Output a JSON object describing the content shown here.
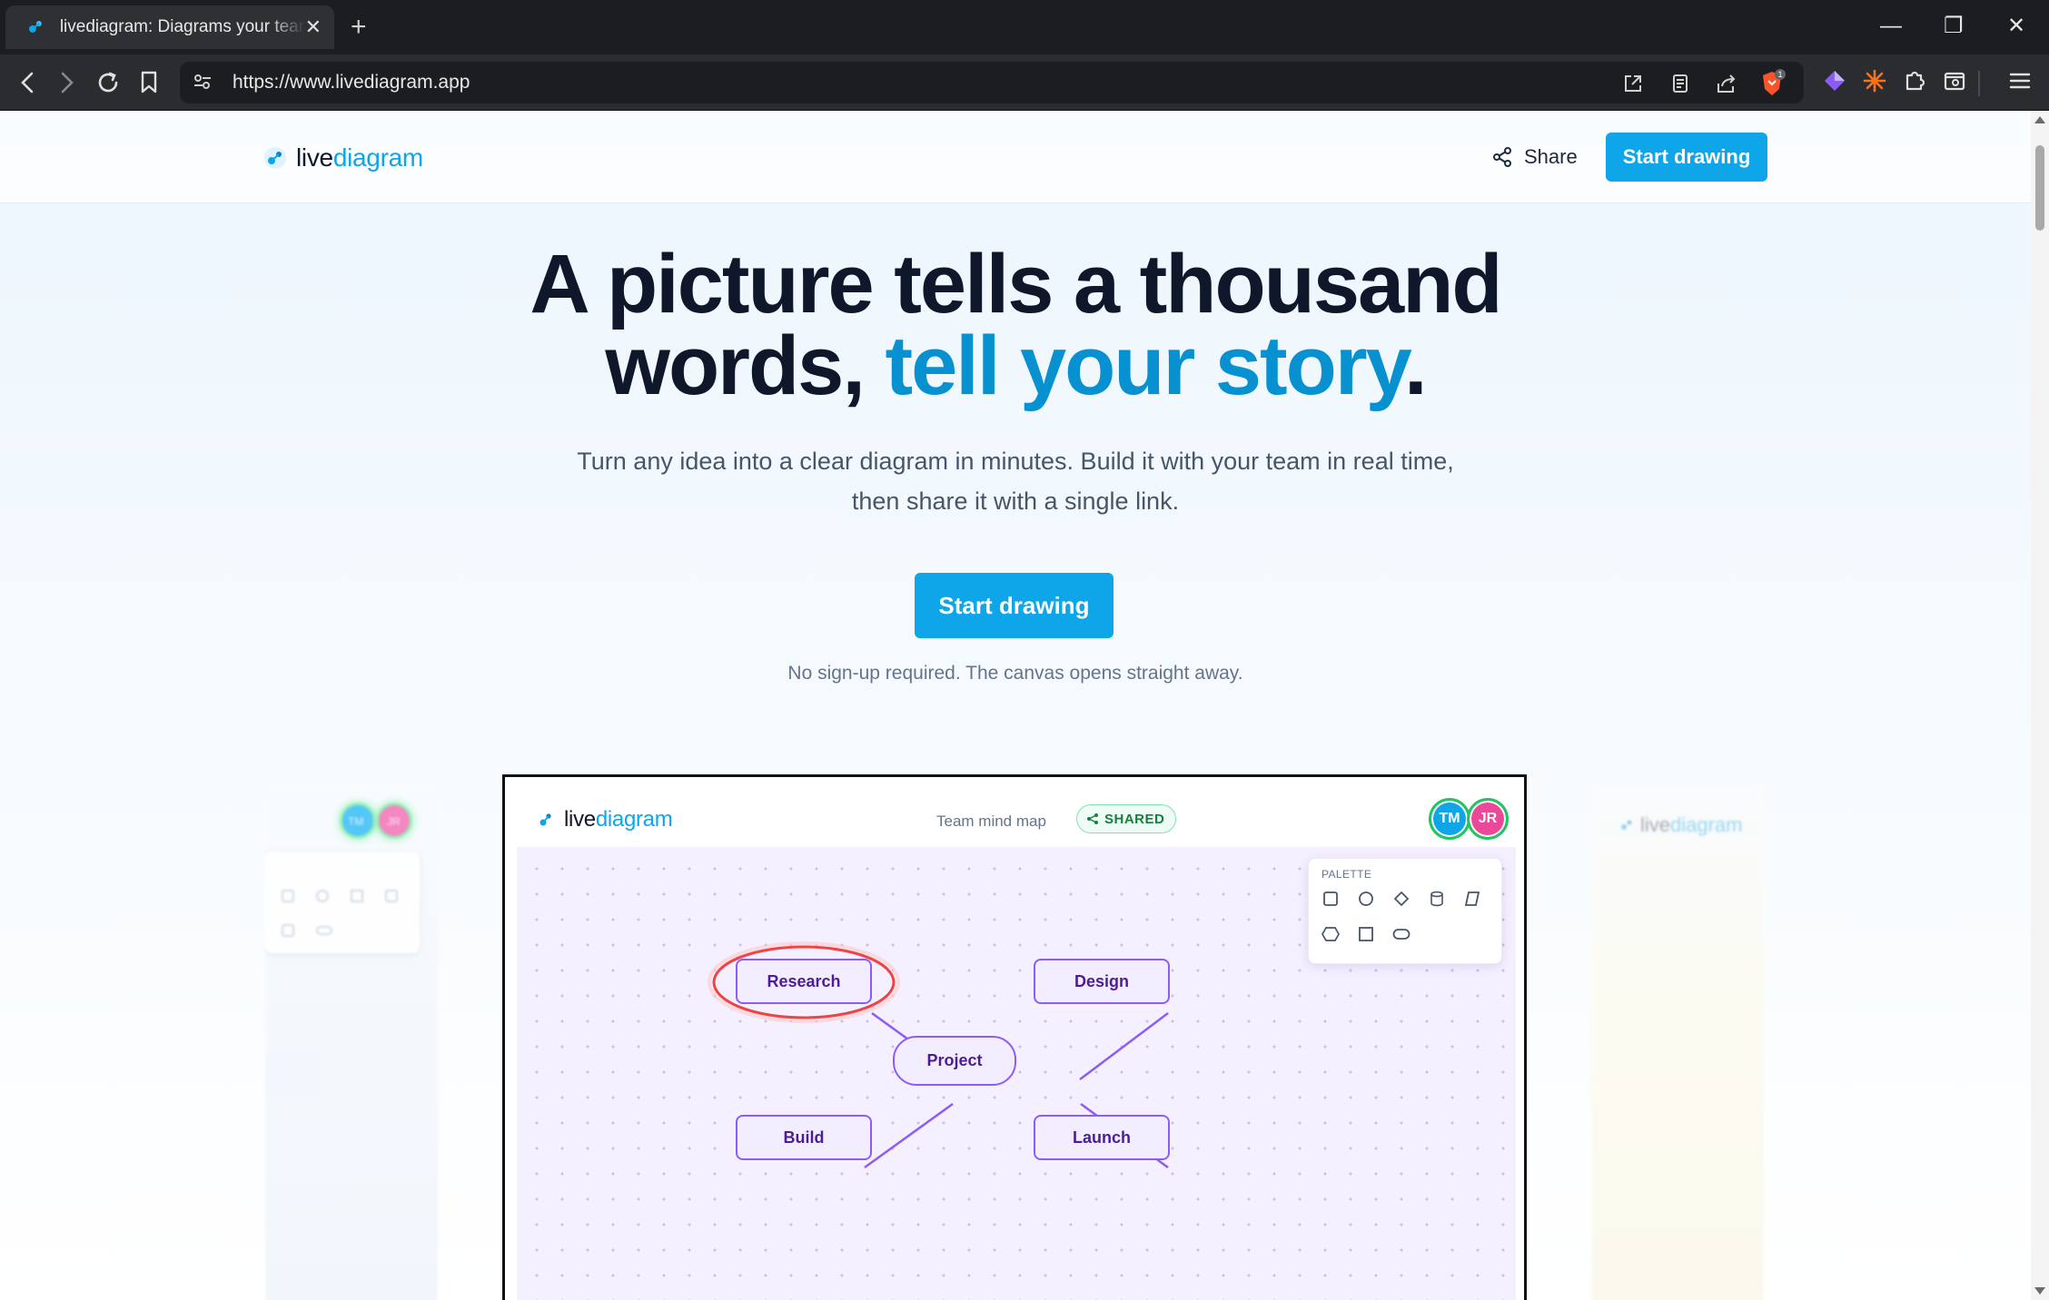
{
  "browser": {
    "tab_title": "livediagram: Diagrams your team",
    "tab_close": "✕",
    "new_tab": "+",
    "url": "https://www.livediagram.app",
    "nav": {
      "back": "‹",
      "forward": "›",
      "reload": "⟳"
    },
    "window": {
      "minimize": "—",
      "restore": "❐",
      "close": "✕"
    },
    "extension_badge_count": "1"
  },
  "header": {
    "brand_part1": "live",
    "brand_part2": "diagram",
    "share_label": "Share",
    "cta_label": "Start drawing"
  },
  "hero": {
    "title_line1": "A picture tells a thousand",
    "title_line2_prefix": "words, ",
    "title_accent": "tell your story",
    "title_suffix": ".",
    "subtitle_line1": "Turn any idea into a clear diagram in minutes. Build it with your team in real time,",
    "subtitle_line2": "then share it with a single link.",
    "cta_label": "Start drawing",
    "note": "No sign-up required. The canvas opens straight away."
  },
  "preview": {
    "brand_part1": "live",
    "brand_part2": "diagram",
    "doc_title": "Team mind map",
    "badge": "SHARED",
    "avatars": [
      {
        "initials": "TM",
        "color": "#0ea5e9"
      },
      {
        "initials": "JR",
        "color": "#ec4899"
      }
    ],
    "palette_title": "PALETTE",
    "palette_tools": [
      "rectangle-icon",
      "circle-icon",
      "diamond-icon",
      "cylinder-icon",
      "parallelogram-icon",
      "hexagon-icon",
      "square-icon",
      "pill-icon"
    ],
    "nodes": {
      "research": "Research",
      "design": "Design",
      "project": "Project",
      "build": "Build",
      "launch": "Launch"
    }
  },
  "colors": {
    "brand": "#0ea5e9",
    "accent_text": "#0891d1",
    "node_border": "#8b5cf6",
    "node_text": "#4c1d95",
    "highlight": "#ef4444",
    "shared_green": "#15803d"
  },
  "side_previews": {
    "left_avatars": [
      "TM",
      "JR"
    ],
    "right_brand_part1": "live",
    "right_brand_part2": "diagram"
  }
}
